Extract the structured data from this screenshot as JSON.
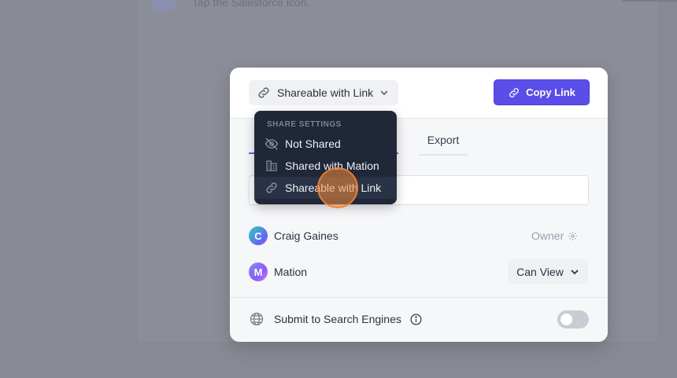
{
  "background": {
    "step_text": "Tap the Salesforce icon."
  },
  "header": {
    "share_select_label": "Shareable with Link",
    "copy_link_label": "Copy Link"
  },
  "tabs": {
    "export_label": "Export"
  },
  "people": [
    {
      "initial": "C",
      "name": "Craig Gaines",
      "role": "Owner"
    },
    {
      "initial": "M",
      "name": "Mation",
      "permission": "Can View"
    }
  ],
  "seo": {
    "label": "Submit to Search Engines",
    "enabled": false
  },
  "dropdown": {
    "heading": "SHARE SETTINGS",
    "items": [
      {
        "label": "Not Shared",
        "icon": "eye-off-icon"
      },
      {
        "label": "Shared with Mation",
        "icon": "building-icon"
      },
      {
        "label": "Shareable with Link",
        "icon": "link-icon",
        "selected": true
      }
    ]
  },
  "colors": {
    "accent": "#5b4ee8",
    "dropdown_bg": "#1f2738",
    "click_marker": "#f58c3c"
  }
}
